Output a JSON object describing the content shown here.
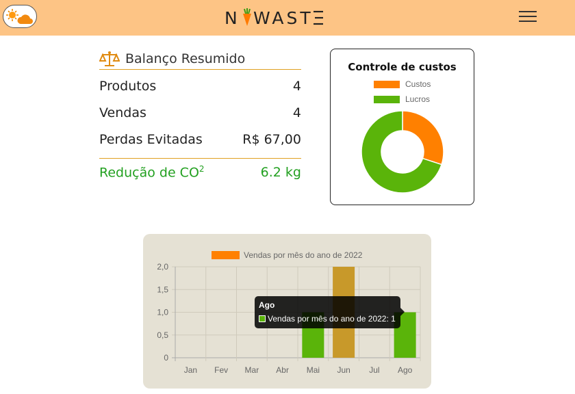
{
  "header": {
    "logo_text": "NOWASTE",
    "theme_toggle_icon": "sun-cloud-icon",
    "menu_icon": "hamburger-menu-icon",
    "background_color": "#fdc485"
  },
  "summary": {
    "title": "Balanço Resumido",
    "title_icon": "scale-balance-icon",
    "rows": [
      {
        "label": "Produtos",
        "value": "4"
      },
      {
        "label": "Vendas",
        "value": "4"
      },
      {
        "label": "Perdas Evitadas",
        "value": "R$ 67,00"
      }
    ],
    "co2": {
      "label": "Redução de CO",
      "superscript": "2",
      "value": "6.2 kg",
      "color": "#22a020"
    }
  },
  "cost_chart": {
    "title": "Controle de custos",
    "chart_data": {
      "type": "pie",
      "donut": true,
      "legend_position": "top",
      "series": [
        {
          "name": "Custos",
          "value": 30,
          "color": "#ff8000"
        },
        {
          "name": "Lucros",
          "value": 70,
          "color": "#5ab40a"
        }
      ]
    }
  },
  "sales_chart": {
    "tooltip": {
      "title": "Ago",
      "line": "Vendas por mês do ano de 2022: 1"
    },
    "chart_data": {
      "type": "bar",
      "legend_position": "top",
      "series_name": "Vendas por mês do ano de 2022",
      "legend_color": "#ff8000",
      "categories": [
        "Jan",
        "Fev",
        "Mar",
        "Abr",
        "Mai",
        "Jun",
        "Jul",
        "Ago"
      ],
      "values": [
        0,
        0,
        0,
        0,
        1,
        2,
        0,
        1
      ],
      "bar_colors": [
        "#5ab40a",
        "#5ab40a",
        "#5ab40a",
        "#5ab40a",
        "#5ab40a",
        "#c8992a",
        "#5ab40a",
        "#5ab40a"
      ],
      "ylim": [
        0,
        2
      ],
      "yticks": [
        "2,0",
        "1,5",
        "1,0",
        "0,5",
        "0"
      ],
      "grid": true
    }
  }
}
